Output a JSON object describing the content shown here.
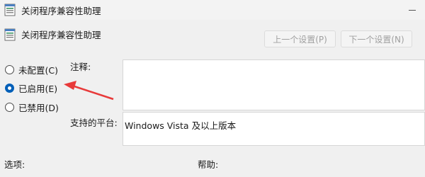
{
  "window": {
    "title": "关闭程序兼容性助理",
    "app_icon": "policy-settings-icon",
    "controls": [
      "minimize-icon"
    ]
  },
  "header": {
    "policy_title": "关闭程序兼容性助理",
    "prev_label": "上一个设置(P)",
    "next_label": "下一个设置(N)"
  },
  "options": [
    {
      "label": "未配置(C)",
      "selected": false
    },
    {
      "label": "已启用(E)",
      "selected": true
    },
    {
      "label": "已禁用(D)",
      "selected": false
    }
  ],
  "fields": {
    "comment_label": "注释:",
    "comment_value": "",
    "supported_label": "支持的平台:",
    "supported_value": "Windows Vista 及以上版本"
  },
  "footer": {
    "options_label": "选项:",
    "help_label": "帮助:"
  },
  "annotation": {
    "arrow_icon": "red-arrow-icon",
    "color": "#e83a3a"
  },
  "colors": {
    "accent": "#005fb8",
    "window_bg": "#f0f0f0"
  }
}
